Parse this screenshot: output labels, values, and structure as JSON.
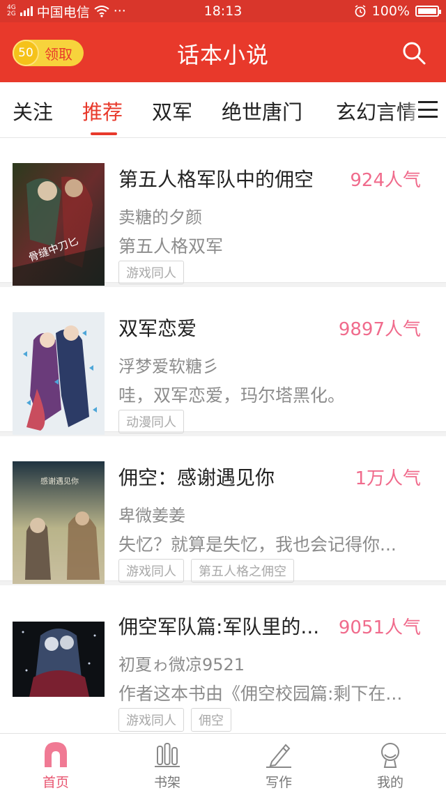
{
  "status_bar": {
    "network_top": "4G",
    "network_bottom": "2G",
    "carrier": "中国电信",
    "more": "···",
    "time": "18:13",
    "battery": "100%"
  },
  "header": {
    "reward_count": "50",
    "reward_label": "领取",
    "title": "话本小说"
  },
  "tabs": [
    {
      "label": "关注"
    },
    {
      "label": "推荐"
    },
    {
      "label": "双军"
    },
    {
      "label": "绝世唐门"
    },
    {
      "label": "玄幻言情"
    }
  ],
  "active_tab": "推荐",
  "books": [
    {
      "title": "第五人格军队中的佣空",
      "popularity": "924人气",
      "author": "卖糖的夕颜",
      "description": "第五人格双军",
      "tags": [
        "游戏同人"
      ],
      "cover_text": "骨缝中刀匕"
    },
    {
      "title": "双军恋爱",
      "popularity": "9897人气",
      "author": "浮梦爱软糖彡",
      "description": "哇，双军恋爱，玛尔塔黑化。",
      "tags": [
        "动漫同人"
      ]
    },
    {
      "title": "佣空：感谢遇见你",
      "popularity": "1万人气",
      "author": "卑微姜姜",
      "description": "失忆？就算是失忆，我也会记得你...",
      "tags": [
        "游戏同人",
        "第五人格之佣空"
      ],
      "cover_text": "感谢遇见你"
    },
    {
      "title": "佣空军队篇:军队里的...",
      "popularity": "9051人气",
      "author": "初夏ゎ微凉9521",
      "description": "作者这本书由《佣空校园篇:剩下在...",
      "tags": [
        "游戏同人",
        "佣空"
      ]
    }
  ],
  "bottom_nav": [
    {
      "label": "首页",
      "icon": "home-icon"
    },
    {
      "label": "书架",
      "icon": "bookshelf-icon"
    },
    {
      "label": "写作",
      "icon": "pen-icon"
    },
    {
      "label": "我的",
      "icon": "profile-icon"
    }
  ],
  "colors": {
    "primary_red": "#e8392b",
    "popularity_pink": "#f06b8c",
    "nav_active": "#e8546f"
  }
}
